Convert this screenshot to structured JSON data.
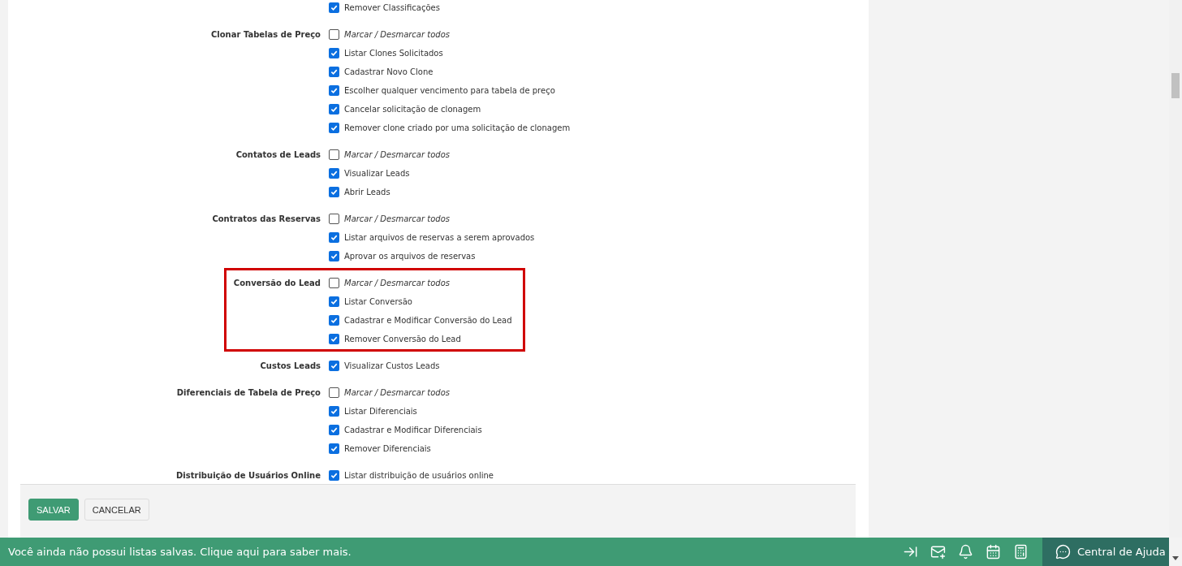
{
  "groups": [
    {
      "highlighted": false,
      "items": [
        {
          "kind": "permission",
          "label": "Remover Classificações",
          "checked": true
        }
      ]
    },
    {
      "label": "Clonar Tabelas de Preço",
      "highlighted": false,
      "items": [
        {
          "kind": "toggle_all",
          "label": "Marcar / Desmarcar todos",
          "checked": false
        },
        {
          "kind": "permission",
          "label": "Listar Clones Solicitados",
          "checked": true
        },
        {
          "kind": "permission",
          "label": "Cadastrar Novo Clone",
          "checked": true
        },
        {
          "kind": "permission",
          "label": "Escolher qualquer vencimento para tabela de preço",
          "checked": true
        },
        {
          "kind": "permission",
          "label": "Cancelar solicitação de clonagem",
          "checked": true
        },
        {
          "kind": "permission",
          "label": "Remover clone criado por uma solicitação de clonagem",
          "checked": true
        }
      ]
    },
    {
      "label": "Contatos de Leads",
      "highlighted": false,
      "items": [
        {
          "kind": "toggle_all",
          "label": "Marcar / Desmarcar todos",
          "checked": false
        },
        {
          "kind": "permission",
          "label": "Visualizar Leads",
          "checked": true
        },
        {
          "kind": "permission",
          "label": "Abrir Leads",
          "checked": true
        }
      ]
    },
    {
      "label": "Contratos das Reservas",
      "highlighted": false,
      "items": [
        {
          "kind": "toggle_all",
          "label": "Marcar / Desmarcar todos",
          "checked": false
        },
        {
          "kind": "permission",
          "label": "Listar arquivos de reservas a serem aprovados",
          "checked": true
        },
        {
          "kind": "permission",
          "label": "Aprovar os arquivos de reservas",
          "checked": true
        }
      ]
    },
    {
      "label": "Conversão do Lead",
      "highlighted": true,
      "items": [
        {
          "kind": "toggle_all",
          "label": "Marcar / Desmarcar todos",
          "checked": false
        },
        {
          "kind": "permission",
          "label": "Listar Conversão",
          "checked": true
        },
        {
          "kind": "permission",
          "label": "Cadastrar e Modificar Conversão do Lead",
          "checked": true
        },
        {
          "kind": "permission",
          "label": "Remover Conversão do Lead",
          "checked": true
        }
      ]
    },
    {
      "label": "Custos Leads",
      "highlighted": false,
      "items": [
        {
          "kind": "permission",
          "label": "Visualizar Custos Leads",
          "checked": true
        }
      ]
    },
    {
      "label": "Diferenciais de Tabela de Preço",
      "highlighted": false,
      "items": [
        {
          "kind": "toggle_all",
          "label": "Marcar / Desmarcar todos",
          "checked": false
        },
        {
          "kind": "permission",
          "label": "Listar Diferenciais",
          "checked": true
        },
        {
          "kind": "permission",
          "label": "Cadastrar e Modificar Diferenciais",
          "checked": true
        },
        {
          "kind": "permission",
          "label": "Remover Diferenciais",
          "checked": true
        }
      ]
    },
    {
      "label": "Distribuição de Usuários Online",
      "highlighted": false,
      "items": [
        {
          "kind": "permission",
          "label": "Listar distribuição de usuários online",
          "checked": true
        }
      ]
    }
  ],
  "buttons": [
    {
      "kind": "primary",
      "label": "SALVAR"
    },
    {
      "kind": "secondary",
      "label": "CANCELAR"
    }
  ],
  "status_bar": {
    "message": "Você ainda não possui listas salvas. Clique aqui para saber mais.",
    "help": "Central de Ajuda"
  }
}
